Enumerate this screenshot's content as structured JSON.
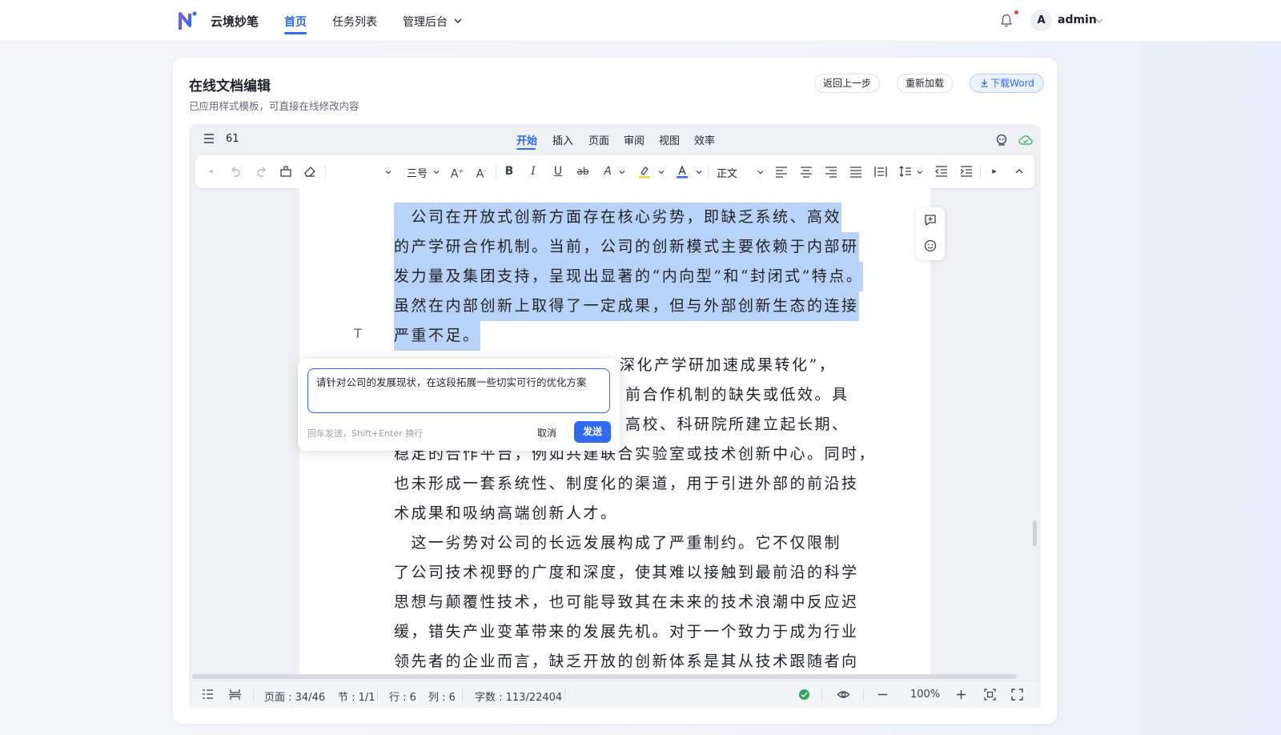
{
  "app": {
    "brand": "云境妙笔",
    "nav": [
      {
        "label": "首页",
        "active": true
      },
      {
        "label": "任务列表",
        "active": false
      },
      {
        "label": "管理后台",
        "active": false
      }
    ],
    "user": {
      "avatar_letter": "A",
      "name": "admin"
    },
    "accent_color": "#2f6bf2"
  },
  "page": {
    "title": "在线文档编辑",
    "subtitle": "已应用样式模板，可直接在线修改内容",
    "buttons": {
      "back": "返回上一步",
      "reload": "重新加载",
      "download": "下载Word"
    }
  },
  "editor": {
    "doc_number": "61",
    "tabs": [
      {
        "label": "开始",
        "active": true
      },
      {
        "label": "插入",
        "active": false
      },
      {
        "label": "页面",
        "active": false
      },
      {
        "label": "审阅",
        "active": false
      },
      {
        "label": "视图",
        "active": false
      },
      {
        "label": "效率",
        "active": false
      }
    ],
    "toolbar": {
      "font_size": "三号",
      "style": "正文",
      "icons": [
        "back-icon",
        "undo-icon",
        "redo-icon",
        "format-painter-icon",
        "eraser-icon",
        "font-grow-icon",
        "font-shrink-icon",
        "bold-icon",
        "italic-icon",
        "underline-icon",
        "strikethrough-icon",
        "text-effect-icon",
        "highlight-icon",
        "font-color-icon",
        "align-left-icon",
        "align-center-icon",
        "align-right-icon",
        "justify-icon",
        "distributed-icon",
        "line-spacing-icon",
        "outdent-icon",
        "indent-icon",
        "play-icon",
        "collapse-icon"
      ]
    },
    "paragraphs": {
      "highlighted": [
        "　公司在开放式创新方面存在核心劣势，即缺乏系统、高效",
        "的产学研合作机制。当前，公司的创新模式主要依赖于内部研",
        "发力量及集团支持，呈现出显著的“内向型”和“封闭式”特点。",
        "虽然在内部创新上取得了一定成果，但与外部创新生态的连接",
        "严重不足。"
      ],
      "partial": [
        "深化产学研加速成果转化”，",
        "前合作机制的缺失或低效。具",
        "高校、科研院所建立起长期、",
        "稳定的合作平台，例如共建联合实验室或技术创新中心。同时，",
        "也未形成一套系统性、制度化的渠道，用于引进外部的前沿技",
        "术成果和吸纳高端创新人才。"
      ],
      "next": [
        "　这一劣势对公司的长远发展构成了严重制约。它不仅限制",
        "了公司技术视野的广度和深度，使其难以接触到最前沿的科学",
        "思想与颠覆性技术，也可能导致其在未来的技术浪潮中反应迟",
        "缓，错失产业变革带来的发展先机。对于一个致力于成为行业",
        "领先者的企业而言，缺乏开放的创新体系是其从技术跟随者向"
      ]
    },
    "highlight_color": "#b9d2f7"
  },
  "ai_popup": {
    "input_value": "请针对公司的发展现状，在这段拓展一些切实可行的优化方案",
    "hint": "回车发送，Shift+Enter 换行",
    "cancel": "取消",
    "send": "发送"
  },
  "statusbar": {
    "page": "页面 : 34/46",
    "section": "节 : 1/1",
    "row": "行 : 6",
    "col": "列 : 6",
    "words": "字数 : 113/22404",
    "zoom": "100%"
  }
}
